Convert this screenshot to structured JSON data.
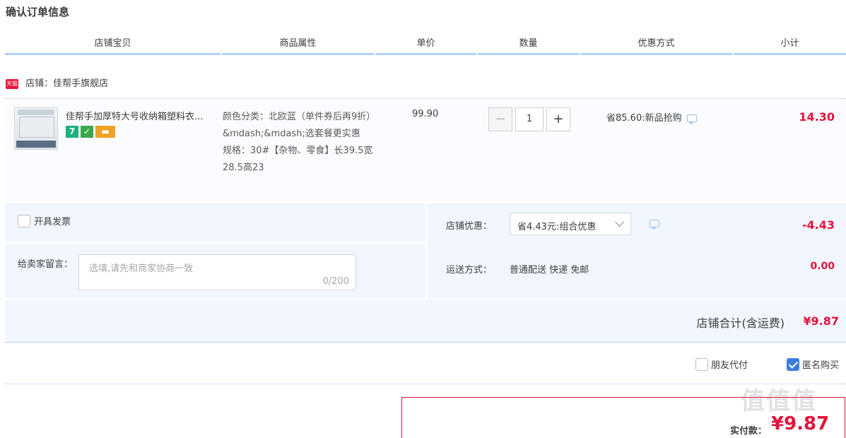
{
  "page_title": "确认订单信息",
  "columns": [
    "店铺宝贝",
    "商品属性",
    "单价",
    "数量",
    "优惠方式",
    "小计"
  ],
  "shop": {
    "badge": "天猫",
    "label": "店铺：佳帮手旗舰店"
  },
  "item": {
    "name": "佳帮手加厚特大号收纳箱塑料衣...",
    "badge_7": "7",
    "attr_color": "颜色分类：北欧蓝（单件券后再9折）&mdash;&mdash;选套餐更实惠",
    "attr_spec": "规格：30#【杂物、零食】长39.5宽28.5高23",
    "unit_price": "99.90",
    "quantity": "1",
    "qty_minus": "−",
    "qty_plus": "+",
    "promo": "省85.60:新品抢购",
    "subtotal": "14.30"
  },
  "extras": {
    "invoice_label": "开具发票",
    "message_label": "给卖家留言：",
    "message_placeholder": "选填,请先和商家协商一致",
    "message_count": "0/200",
    "discount_label": "店铺优惠：",
    "discount_selected": "省4.43元:组合优惠",
    "discount_value": "-4.43",
    "shipping_label": "运送方式：",
    "shipping_method": "普通配送 快递 免邮",
    "shipping_value": "0.00"
  },
  "shop_total": {
    "label": "店铺合计(含运费)",
    "value": "¥9.87"
  },
  "options": {
    "friend_pay": "朋友代付",
    "friend_pay_checked": false,
    "anonymous": "匿名购买",
    "anonymous_checked": true
  },
  "payment": {
    "label": "实付款：",
    "value": "¥9.87"
  },
  "watermark": "值值值",
  "colors": {
    "accent_red": "#e4123b",
    "header_blue": "#b2d1ff",
    "panel_bg": "#f2f7ff",
    "check_blue": "#3d7de0"
  }
}
